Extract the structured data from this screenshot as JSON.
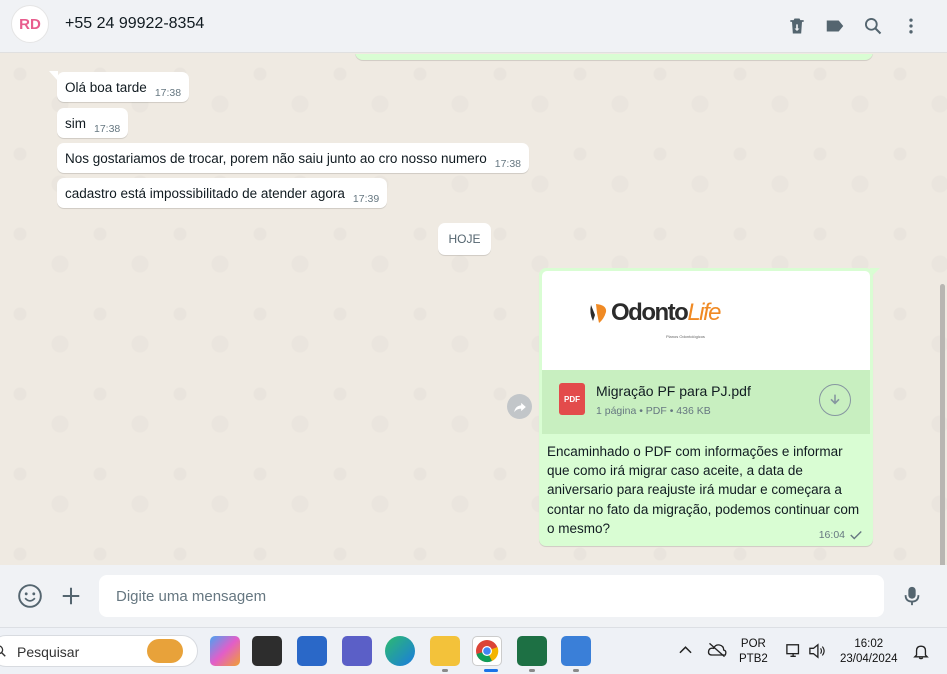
{
  "header": {
    "avatar_initials": "RD",
    "contact": "+55 24 99922-8354",
    "icons": [
      "delete-icon",
      "label-icon",
      "search-icon",
      "menu-icon"
    ]
  },
  "messages": [
    {
      "text": "Olá boa tarde",
      "time": "17:38"
    },
    {
      "text": "sim",
      "time": "17:38"
    },
    {
      "text": "Nos gostariamos de trocar, porem não saiu junto ao cro nosso numero",
      "time": "17:38"
    },
    {
      "text": "cadastro está impossibilitado de atender agora",
      "time": "17:39"
    }
  ],
  "date_divider": "HOJE",
  "document": {
    "preview_brand": "Odonto",
    "preview_brand_accent": "Life",
    "preview_subtitle": "Planos Odontológicos",
    "badge": "PDF",
    "name": "Migração PF para PJ.pdf",
    "meta": "1 página • PDF • 436 KB",
    "caption": "Encaminhado o PDF com informações e informar que como irá migrar caso aceite, a data de aniversario para reajuste irá mudar e começara a contar no fato da migração, podemos continuar com o mesmo?",
    "time": "16:04"
  },
  "composer": {
    "placeholder": "Digite uma mensagem"
  },
  "taskbar": {
    "search_label": "Pesquisar",
    "lang_top": "POR",
    "lang_bottom": "PTB2",
    "clock_time": "16:02",
    "clock_date": "23/04/2024"
  },
  "colors": {
    "outgoing_bubble": "#d9fdd3",
    "incoming_bubble": "#ffffff",
    "chat_bg": "#efeae2",
    "pdf_red": "#e34b4b",
    "brand_orange": "#f08a24"
  }
}
